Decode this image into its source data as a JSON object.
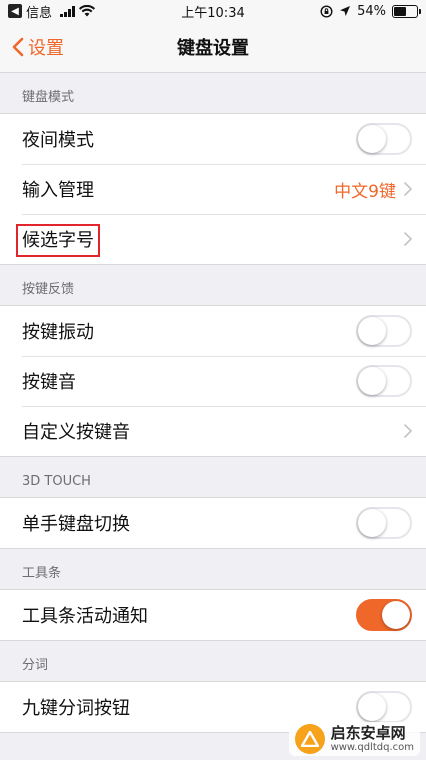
{
  "status_bar": {
    "back_app": "信息",
    "time": "上午10:34",
    "battery_pct": "54%",
    "battery_level": 0.54
  },
  "nav": {
    "back_label": "设置",
    "title": "键盘设置"
  },
  "sections": [
    {
      "header": "键盘模式",
      "rows": [
        {
          "label": "夜间模式",
          "type": "toggle",
          "on": false
        },
        {
          "label": "输入管理",
          "type": "value",
          "value": "中文9键"
        },
        {
          "label": "候选字号",
          "type": "chevron",
          "highlighted": true
        }
      ]
    },
    {
      "header": "按键反馈",
      "rows": [
        {
          "label": "按键振动",
          "type": "toggle",
          "on": false
        },
        {
          "label": "按键音",
          "type": "toggle",
          "on": false
        },
        {
          "label": "自定义按键音",
          "type": "chevron"
        }
      ]
    },
    {
      "header": "3D TOUCH",
      "rows": [
        {
          "label": "单手键盘切换",
          "type": "toggle",
          "on": false
        }
      ]
    },
    {
      "header": "工具条",
      "rows": [
        {
          "label": "工具条活动通知",
          "type": "toggle",
          "on": true
        }
      ]
    },
    {
      "header": "分词",
      "rows": [
        {
          "label": "九键分词按钮",
          "type": "toggle",
          "on": false
        }
      ]
    }
  ],
  "watermark": {
    "name": "启东安卓网",
    "url": "www.qdltdq.com"
  },
  "colors": {
    "accent": "#f0672a",
    "highlight": "#e0262b",
    "background": "#efeff4"
  }
}
